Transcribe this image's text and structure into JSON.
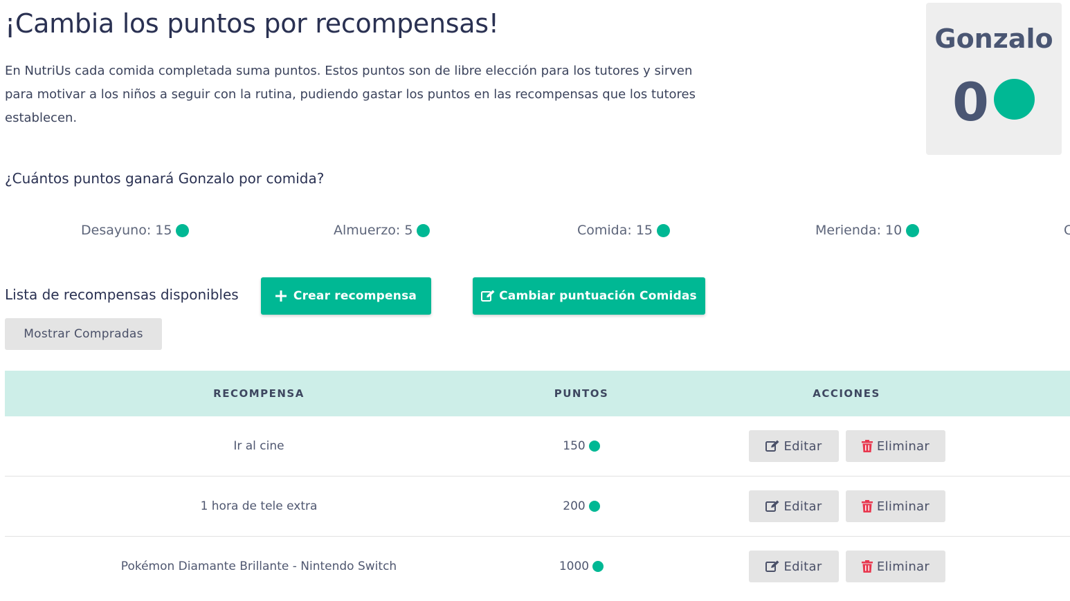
{
  "header": {
    "title": "¡Cambia los puntos por recompensas!",
    "intro": "En NutriUs cada comida completada suma puntos. Estos puntos son de libre elección para los tutores y sirven para motivar a los niños a seguir con la rutina, pudiendo gastar los puntos en las recompensas que los tutores establecen."
  },
  "user": {
    "name": "Gonzalo",
    "points": "0",
    "coin_color": "#00b894"
  },
  "question": "¿Cuántos puntos ganará Gonzalo por comida?",
  "meals": [
    {
      "label": "Desayuno: 15"
    },
    {
      "label": "Almuerzo: 5"
    },
    {
      "label": "Comida: 15"
    },
    {
      "label": "Merienda: 10"
    },
    {
      "label": "C"
    }
  ],
  "rewards_section": {
    "label": "Lista de recompensas disponibles",
    "create_button": "Crear recompensa",
    "change_button": "Cambiar puntuación Comidas",
    "show_bought_button": "Mostrar Compradas"
  },
  "table": {
    "headers": [
      "RECOMPENSA",
      "PUNTOS",
      "ACCIONES"
    ],
    "rows": [
      {
        "reward": "Ir al cine",
        "points": "150"
      },
      {
        "reward": "1 hora de tele extra",
        "points": "200"
      },
      {
        "reward": "Pokémon Diamante Brillante - Nintendo Switch",
        "points": "1000"
      }
    ],
    "edit_label": "Editar",
    "delete_label": "Eliminar"
  },
  "colors": {
    "accent": "#00b894",
    "header_bg": "#cdeee8",
    "delete_icon": "#e8384f"
  },
  "icons": {
    "create": "plus-icon",
    "change": "edit-icon",
    "edit": "edit-icon",
    "delete": "trash-icon",
    "coin": "coin-icon"
  }
}
